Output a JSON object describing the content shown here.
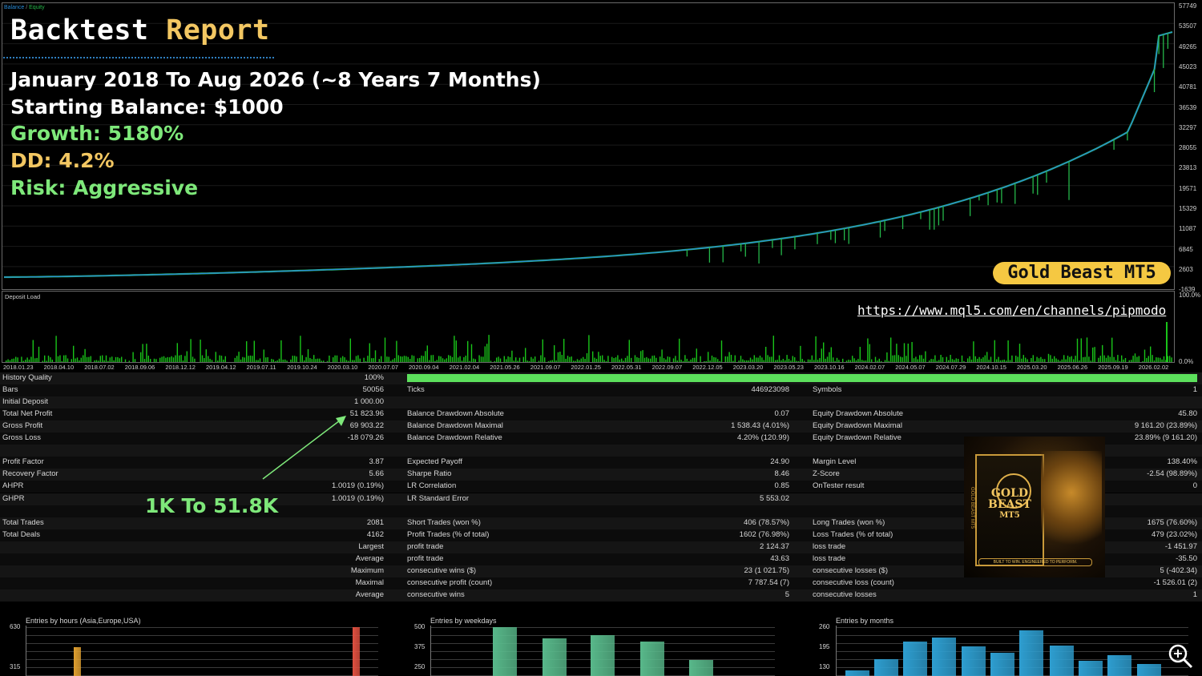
{
  "chart": {
    "legend_balance": "Balance",
    "legend_sep": " / ",
    "legend_equity": "Equity",
    "y_ticks": [
      "57749",
      "53507",
      "49265",
      "45023",
      "40781",
      "36539",
      "32297",
      "28055",
      "23813",
      "19571",
      "15329",
      "11087",
      "6845",
      "2603",
      "-1639"
    ],
    "x_ticks": [
      "2018.01.23",
      "2018.04.10",
      "2018.07.02",
      "2018.09.06",
      "2018.12.12",
      "2019.04.12",
      "2019.07.11",
      "2019.10.24",
      "2020.03.10",
      "2020.07.07",
      "2020.09.04",
      "2021.02.04",
      "2021.05.26",
      "2021.09.07",
      "2022.01.25",
      "2022.05.31",
      "2022.09.07",
      "2022.12.05",
      "2023.03.20",
      "2023.05.23",
      "2023.10.16",
      "2024.02.07",
      "2024.05.07",
      "2024.07.29",
      "2024.10.15",
      "2025.03.20",
      "2025.06.26",
      "2025.09.19",
      "2026.02.02"
    ],
    "colors": {
      "balance": "#2a8cd8",
      "equity": "#25b84a"
    }
  },
  "overlay": {
    "title_a": "Backtest",
    "title_b": "Report",
    "period": "January 2018 To Aug 2026 (~8 Years 7 Months)",
    "start_balance": "Starting Balance: $1000",
    "growth": "Growth: 5180%",
    "dd": "DD: 4.2%",
    "risk": "Risk: Aggressive",
    "badge": "Gold Beast MT5",
    "url": "https://www.mql5.com/en/channels/pipmodo",
    "callout": "1K To 51.8K"
  },
  "deposit_load": {
    "label": "Deposit Load",
    "top": "100.0%",
    "bottom": "0.0%"
  },
  "stats": {
    "history_quality_label": "History Quality",
    "history_quality": "100%",
    "col1": [
      {
        "label": "Bars",
        "value": "50056"
      },
      {
        "label": "Initial Deposit",
        "value": "1 000.00"
      },
      {
        "label": "Total Net Profit",
        "value": "51 823.96"
      },
      {
        "label": "Gross Profit",
        "value": "69 903.22"
      },
      {
        "label": "Gross Loss",
        "value": "-18 079.26"
      },
      {
        "label": "Profit Factor",
        "value": "3.87"
      },
      {
        "label": "Recovery Factor",
        "value": "5.66"
      },
      {
        "label": "AHPR",
        "value": "1.0019 (0.19%)"
      },
      {
        "label": "GHPR",
        "value": "1.0019 (0.19%)"
      },
      {
        "label": "Total Trades",
        "value": "2081"
      },
      {
        "label": "Total Deals",
        "value": "4162"
      }
    ],
    "col1_tail": [
      "Largest",
      "Average",
      "Maximum",
      "Maximal",
      "Average"
    ],
    "col2": [
      {
        "label": "Ticks",
        "value": "446923098"
      },
      {
        "label": "Balance Drawdown Absolute",
        "value": "0.07"
      },
      {
        "label": "Balance Drawdown Maximal",
        "value": "1 538.43 (4.01%)"
      },
      {
        "label": "Balance Drawdown Relative",
        "value": "4.20% (120.99)"
      },
      {
        "label": "Expected Payoff",
        "value": "24.90"
      },
      {
        "label": "Sharpe Ratio",
        "value": "8.46"
      },
      {
        "label": "LR Correlation",
        "value": "0.85"
      },
      {
        "label": "LR Standard Error",
        "value": "5 553.02"
      },
      {
        "label": "Short Trades (won %)",
        "value": "406 (78.57%)"
      },
      {
        "label": "Profit Trades (% of total)",
        "value": "1602 (76.98%)"
      },
      {
        "label": "profit trade",
        "value": "2 124.37"
      },
      {
        "label": "profit trade",
        "value": "43.63"
      },
      {
        "label": "consecutive wins ($)",
        "value": "23 (1 021.75)"
      },
      {
        "label": "consecutive profit (count)",
        "value": "7 787.54 (7)"
      },
      {
        "label": "consecutive wins",
        "value": "5"
      }
    ],
    "col3": [
      {
        "label": "Symbols",
        "value": "1"
      },
      {
        "label": "Equity Drawdown Absolute",
        "value": "45.80"
      },
      {
        "label": "Equity Drawdown Maximal",
        "value": "9 161.20 (23.89%)"
      },
      {
        "label": "Equity Drawdown Relative",
        "value": "23.89% (9 161.20)"
      },
      {
        "label": "Margin Level",
        "value": "138.40%"
      },
      {
        "label": "Z-Score",
        "value": "-2.54 (98.89%)"
      },
      {
        "label": "OnTester result",
        "value": "0"
      },
      {
        "label": "Long Trades (won %)",
        "value": "1675 (76.60%)"
      },
      {
        "label": "Loss Trades (% of total)",
        "value": "479 (23.02%)"
      },
      {
        "label": "loss trade",
        "value": "-1 451.97"
      },
      {
        "label": "loss trade",
        "value": "-35.50"
      },
      {
        "label": "consecutive losses ($)",
        "value": "5 (-402.34)"
      },
      {
        "label": "consecutive loss (count)",
        "value": "-1 526.01 (2)"
      },
      {
        "label": "consecutive losses",
        "value": "1"
      }
    ]
  },
  "bottom_charts": [
    {
      "title": "Entries by hours (Asia,Europe,USA)",
      "y_ticks": [
        "630",
        "315"
      ]
    },
    {
      "title": "Entries by weekdays",
      "y_ticks": [
        "500",
        "375",
        "250"
      ]
    },
    {
      "title": "Entries by months",
      "y_ticks": [
        "260",
        "195",
        "130"
      ]
    }
  ],
  "product_image": {
    "line1": "GOLD",
    "line2": "BEAST",
    "line3": "MT5",
    "tagline": "BUILT TO WIN. ENGINEERED TO PERFORM.",
    "side": "GOLD BEAST MT5"
  }
}
